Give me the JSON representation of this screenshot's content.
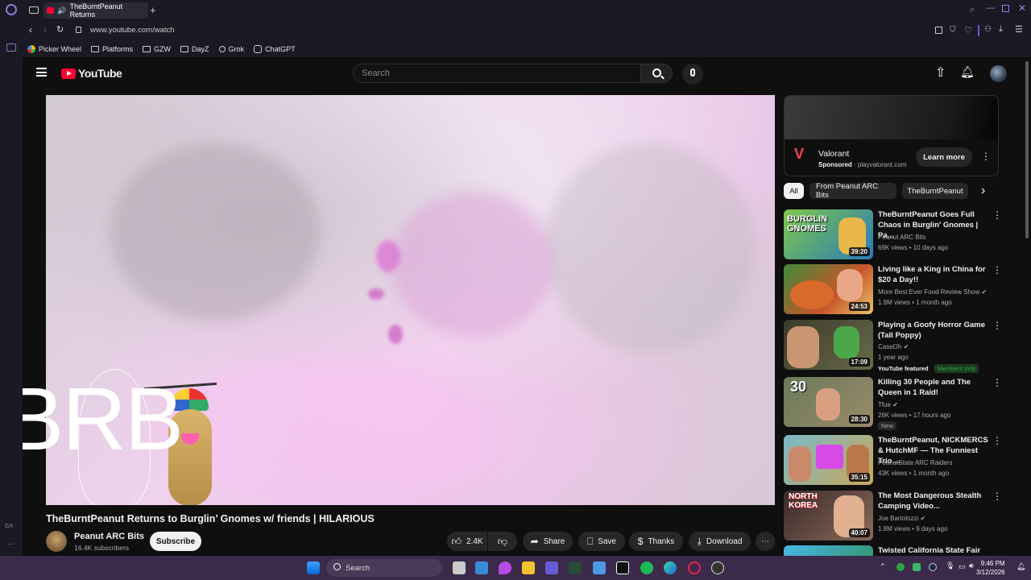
{
  "browser": {
    "tab_title": "TheBurntPeanut Returns",
    "url": "www.youtube.com/watch",
    "bookmarks": [
      "Picker Wheel",
      "Platforms",
      "GZW",
      "DayZ",
      "Grok",
      "ChatGPT"
    ]
  },
  "youtube": {
    "logo_text": "YouTube",
    "search_placeholder": "Search",
    "overlay_text": "BRB",
    "video": {
      "title": "TheBurntPeanut Returns to Burglin’ Gnomes w/ friends | HILARIOUS",
      "channel": "Peanut ARC Bits",
      "subscribers": "16.4K subscribers",
      "subscribe_label": "Subscribe",
      "likes": "2.4K",
      "share_label": "Share",
      "save_label": "Save",
      "thanks_label": "Thanks",
      "download_label": "Download"
    },
    "ad": {
      "title": "Valorant",
      "sponsored": "Sponsored",
      "domain": "playvalorant.com",
      "cta": "Learn more"
    },
    "chips": [
      "All",
      "From Peanut ARC Bits",
      "TheBurntPeanut"
    ],
    "recommendations": [
      {
        "title": "TheBurntPeanut Goes Full Chaos in Burglin' Gnomes | Pa...",
        "channel": "Peanut ARC Bits",
        "meta": "69K views • 10 days ago",
        "duration": "39:20",
        "thumb_text": "BURGLIN GNOMES"
      },
      {
        "title": "Living like a King in China for $20 a Day!!",
        "channel": "More Best Ever Food Review Show ✔",
        "meta": "1.9M views • 1 month ago",
        "duration": "24:53"
      },
      {
        "title": "Playing a Goofy Horror Game (Tall Poppy)",
        "channel": "CaseOh ✔",
        "meta": "1 year ago",
        "duration": "17:09",
        "featured": "YouTube featured",
        "members": "Members only"
      },
      {
        "title": "Killing 30 People and The Queen in 1 Raid!",
        "channel": "Tfue ✔",
        "meta": "26K views • 17 hours ago",
        "duration": "28:30",
        "badge": "New",
        "thumb_text": "30"
      },
      {
        "title": "TheBurntPeanut, NICKMERCS & HutchMF — The Funniest Trio ...",
        "channel": "PeanutState ARC Raiders",
        "meta": "43K views • 1 month ago",
        "duration": "35:15"
      },
      {
        "title": "The Most Dangerous Stealth Camping Video...",
        "channel": "Joe Bartolozzi ✔",
        "meta": "1.8M views • 9 days ago",
        "duration": "40:07",
        "thumb_text": "NORTH KOREA"
      },
      {
        "title": "Twisted California State Fair",
        "channel": "",
        "meta": "",
        "duration": ""
      }
    ]
  },
  "taskbar": {
    "search_label": "Search",
    "time": "9:46 PM",
    "date": "3/12/2026"
  }
}
